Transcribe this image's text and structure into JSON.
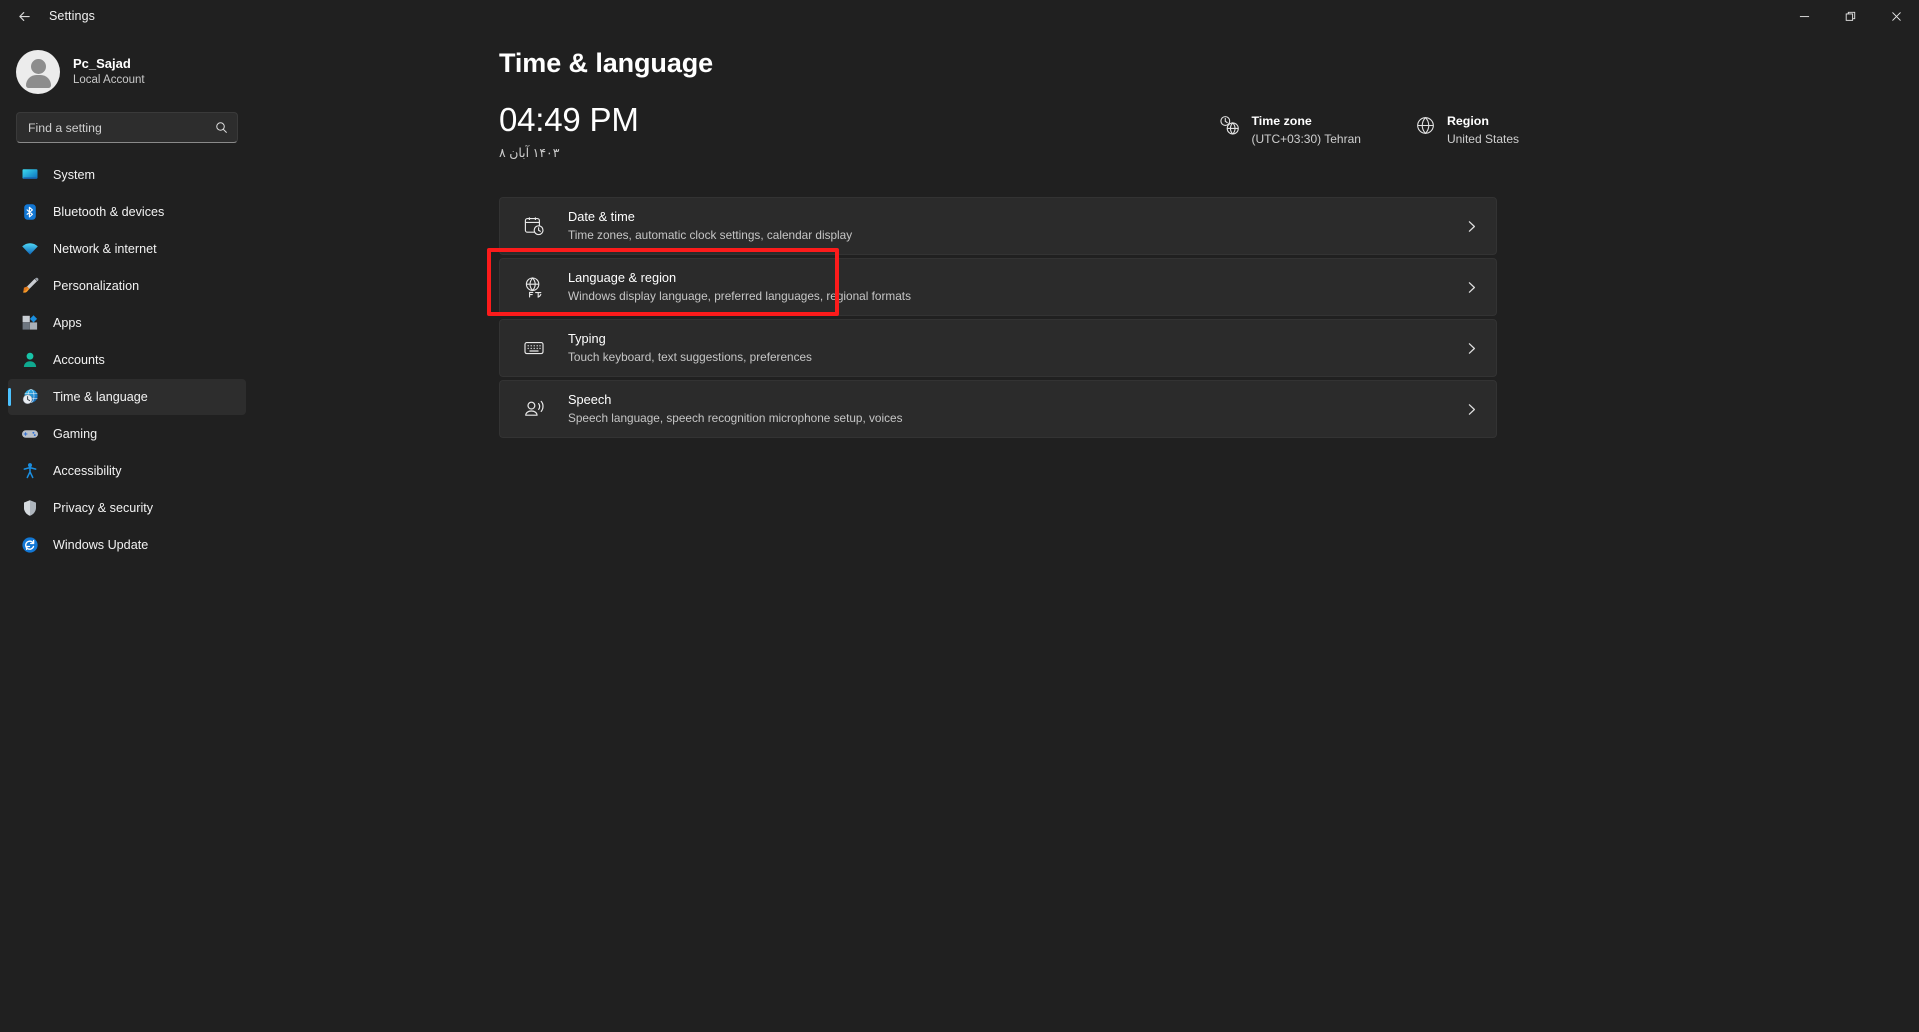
{
  "window": {
    "app_title": "Settings",
    "back_label": "Back",
    "controls": {
      "minimize": "Minimize",
      "restore": "Restore",
      "close": "Close"
    }
  },
  "sidebar": {
    "account": {
      "name": "Pc_Sajad",
      "type": "Local Account"
    },
    "search": {
      "placeholder": "Find a setting",
      "value": ""
    },
    "items": [
      {
        "label": "System",
        "icon": "monitor-icon",
        "active": false
      },
      {
        "label": "Bluetooth & devices",
        "icon": "bluetooth-icon",
        "active": false
      },
      {
        "label": "Network & internet",
        "icon": "wifi-icon",
        "active": false
      },
      {
        "label": "Personalization",
        "icon": "paintbrush-icon",
        "active": false
      },
      {
        "label": "Apps",
        "icon": "apps-icon",
        "active": false
      },
      {
        "label": "Accounts",
        "icon": "person-icon",
        "active": false
      },
      {
        "label": "Time & language",
        "icon": "clock-globe-icon",
        "active": true
      },
      {
        "label": "Gaming",
        "icon": "gamepad-icon",
        "active": false
      },
      {
        "label": "Accessibility",
        "icon": "accessibility-icon",
        "active": false
      },
      {
        "label": "Privacy & security",
        "icon": "shield-icon",
        "active": false
      },
      {
        "label": "Windows Update",
        "icon": "update-icon",
        "active": false
      }
    ]
  },
  "main": {
    "page_title": "Time & language",
    "clock": "04:49 PM",
    "date_fa": "۱۴۰۳ آبان ۸",
    "timezone": {
      "label": "Time zone",
      "value": "(UTC+03:30) Tehran",
      "icon": "clock-globe-icon"
    },
    "region": {
      "label": "Region",
      "value": "United States",
      "icon": "globe-icon"
    },
    "cards": [
      {
        "title": "Date & time",
        "subtitle": "Time zones, automatic clock settings, calendar display",
        "icon": "calendar-clock-icon",
        "highlighted": false
      },
      {
        "title": "Language & region",
        "subtitle": "Windows display language, preferred languages, regional formats",
        "icon": "language-globe-icon",
        "highlighted": true
      },
      {
        "title": "Typing",
        "subtitle": "Touch keyboard, text suggestions, preferences",
        "icon": "keyboard-icon",
        "highlighted": false
      },
      {
        "title": "Speech",
        "subtitle": "Speech language, speech recognition microphone setup, voices",
        "icon": "speech-icon",
        "highlighted": false
      }
    ]
  },
  "colors": {
    "accent": "#4cc2ff",
    "highlight": "#fc1b1b",
    "background": "#202020",
    "card": "#2b2b2b"
  }
}
